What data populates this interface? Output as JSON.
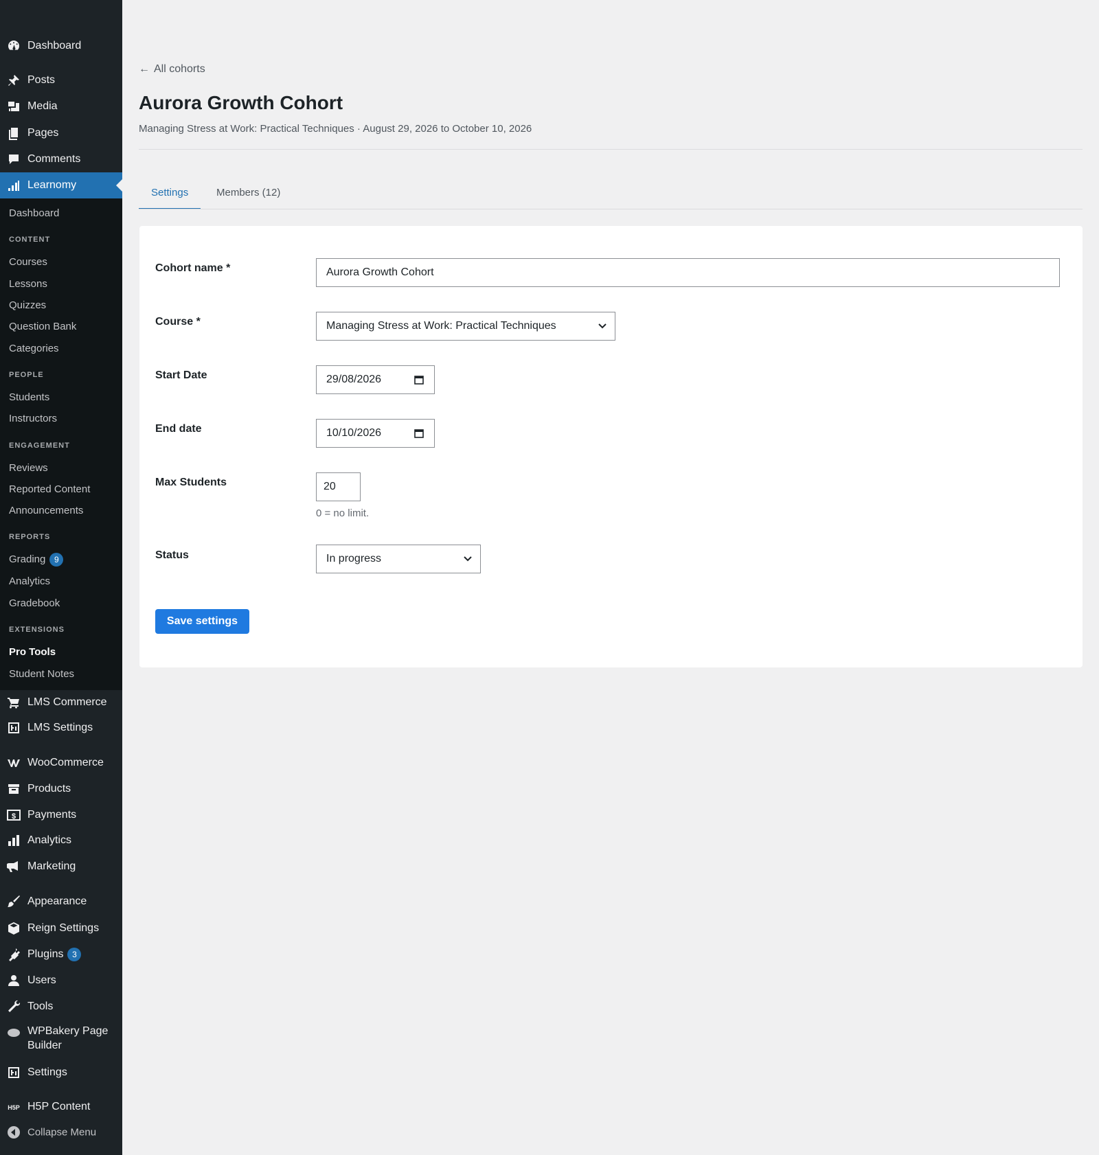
{
  "sidebar": {
    "top_items": [
      {
        "label": "Dashboard",
        "icon": "dashboard-icon"
      },
      {
        "label": "Posts",
        "icon": "pin-icon"
      },
      {
        "label": "Media",
        "icon": "media-icon"
      },
      {
        "label": "Pages",
        "icon": "pages-icon"
      },
      {
        "label": "Comments",
        "icon": "comment-icon"
      },
      {
        "label": "Learnomy",
        "icon": "chart-bars-icon"
      }
    ],
    "learnomy_submenu": {
      "dashboard": "Dashboard",
      "content_head": "CONTENT",
      "courses": "Courses",
      "lessons": "Lessons",
      "quizzes": "Quizzes",
      "question_bank": "Question Bank",
      "categories": "Categories",
      "people_head": "PEOPLE",
      "students": "Students",
      "instructors": "Instructors",
      "engagement_head": "ENGAGEMENT",
      "reviews": "Reviews",
      "reported": "Reported Content",
      "announcements": "Announcements",
      "reports_head": "REPORTS",
      "grading": "Grading",
      "grading_badge": "9",
      "analytics": "Analytics",
      "gradebook": "Gradebook",
      "extensions_head": "EXTENSIONS",
      "pro_tools": "Pro Tools",
      "student_notes": "Student Notes"
    },
    "bottom_items": [
      {
        "label": "LMS Commerce",
        "icon": "cart-icon"
      },
      {
        "label": "LMS Settings",
        "icon": "settings-grid-icon"
      },
      {
        "label": "WooCommerce",
        "icon": "woocommerce-icon"
      },
      {
        "label": "Products",
        "icon": "archive-icon"
      },
      {
        "label": "Payments",
        "icon": "dollar-icon"
      },
      {
        "label": "Analytics",
        "icon": "bar-chart-icon"
      },
      {
        "label": "Marketing",
        "icon": "megaphone-icon"
      },
      {
        "label": "Appearance",
        "icon": "brush-icon"
      },
      {
        "label": "Reign Settings",
        "icon": "box-icon"
      },
      {
        "label": "Plugins",
        "icon": "plugin-icon",
        "badge": "3"
      },
      {
        "label": "Users",
        "icon": "user-icon"
      },
      {
        "label": "Tools",
        "icon": "wrench-icon"
      },
      {
        "label": "WPBakery Page Builder",
        "icon": "cloud-icon"
      },
      {
        "label": "Settings",
        "icon": "settings-grid-icon"
      },
      {
        "label": "H5P Content",
        "icon": "h5p-icon"
      },
      {
        "label": "Collapse Menu",
        "icon": "collapse-icon"
      }
    ]
  },
  "main": {
    "back_link": "All cohorts",
    "title": "Aurora Growth Cohort",
    "subtitle": "Managing Stress at Work: Practical Techniques · August 29, 2026 to October 10, 2026",
    "tabs": [
      {
        "label": "Settings"
      },
      {
        "label": "Members (12)"
      }
    ],
    "form": {
      "cohort_name_label": "Cohort name *",
      "cohort_name_value": "Aurora Growth Cohort",
      "course_label": "Course *",
      "course_value": "Managing Stress at Work: Practical Techniques",
      "start_label": "Start Date",
      "start_value": "29/08/2026",
      "end_label": "End date",
      "end_value": "10/10/2026",
      "max_label": "Max Students",
      "max_value": "20",
      "max_hint": "0 = no limit.",
      "status_label": "Status",
      "status_value": "In progress",
      "save_label": "Save settings"
    }
  },
  "colors": {
    "accent": "#2271b1",
    "button": "#1f7ae0",
    "sidebar": "#1d2327",
    "submenu": "#101517",
    "background": "#f0f0f1"
  }
}
